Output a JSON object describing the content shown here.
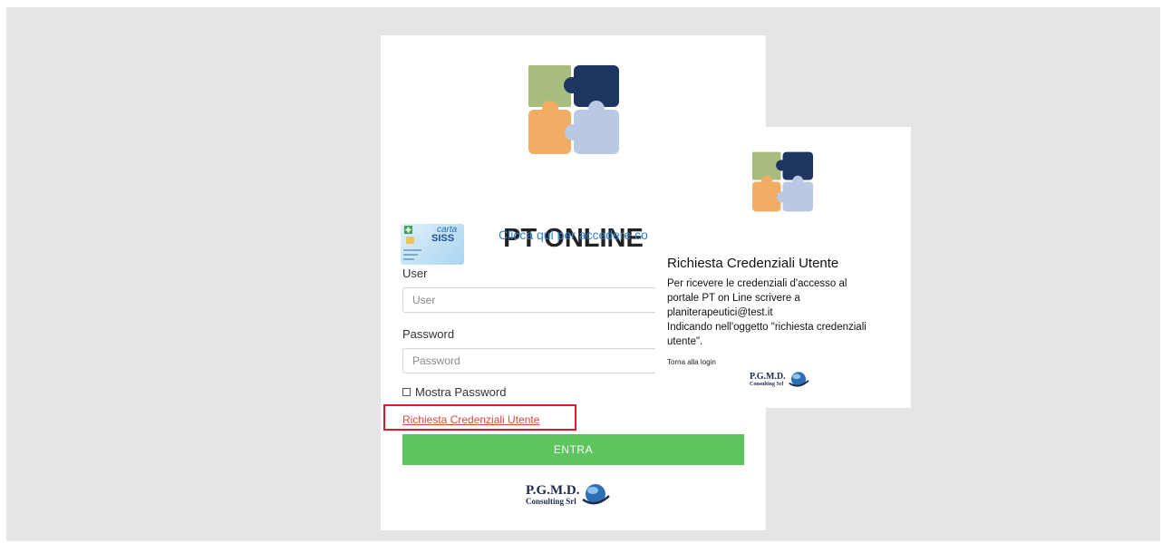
{
  "login": {
    "title": "PT ONLINE",
    "siss_card": {
      "brand_top": "carta",
      "brand_bottom": "SISS"
    },
    "siss_link": "Clicca qui per accedere co",
    "user_label": "User",
    "user_placeholder": "User",
    "password_label": "Password",
    "password_placeholder": "Password",
    "show_password_label": "Mostra Password",
    "request_credentials_link": "Richiesta Credenziali Utente",
    "submit_label": "ENTRA",
    "company": {
      "name": "P.G.M.D.",
      "tagline": "Consulting Srl"
    }
  },
  "popup": {
    "title": "Richiesta Credenziali Utente",
    "lines": [
      "Per ricevere le credenziali d'accesso al",
      "portale PT on Line scrivere a",
      "planiterapeutici@test.it",
      "Indicando nell'oggetto \"richiesta credenziali",
      "utente\"."
    ],
    "back_link": "Torna alla login",
    "company": {
      "name": "P.G.M.D.",
      "tagline": "Consulting Srl"
    }
  },
  "colors": {
    "puzzle_green": "#a8bc80",
    "puzzle_navy": "#1e3560",
    "puzzle_orange": "#f2ad64",
    "puzzle_lightblue": "#b9c9e1",
    "button_green": "#5dc460",
    "highlight_red": "#e01a2e",
    "link_blue": "#2f7fd0"
  },
  "icons": [
    "puzzle-logo-icon",
    "carta-siss-icon",
    "globe-icon"
  ]
}
